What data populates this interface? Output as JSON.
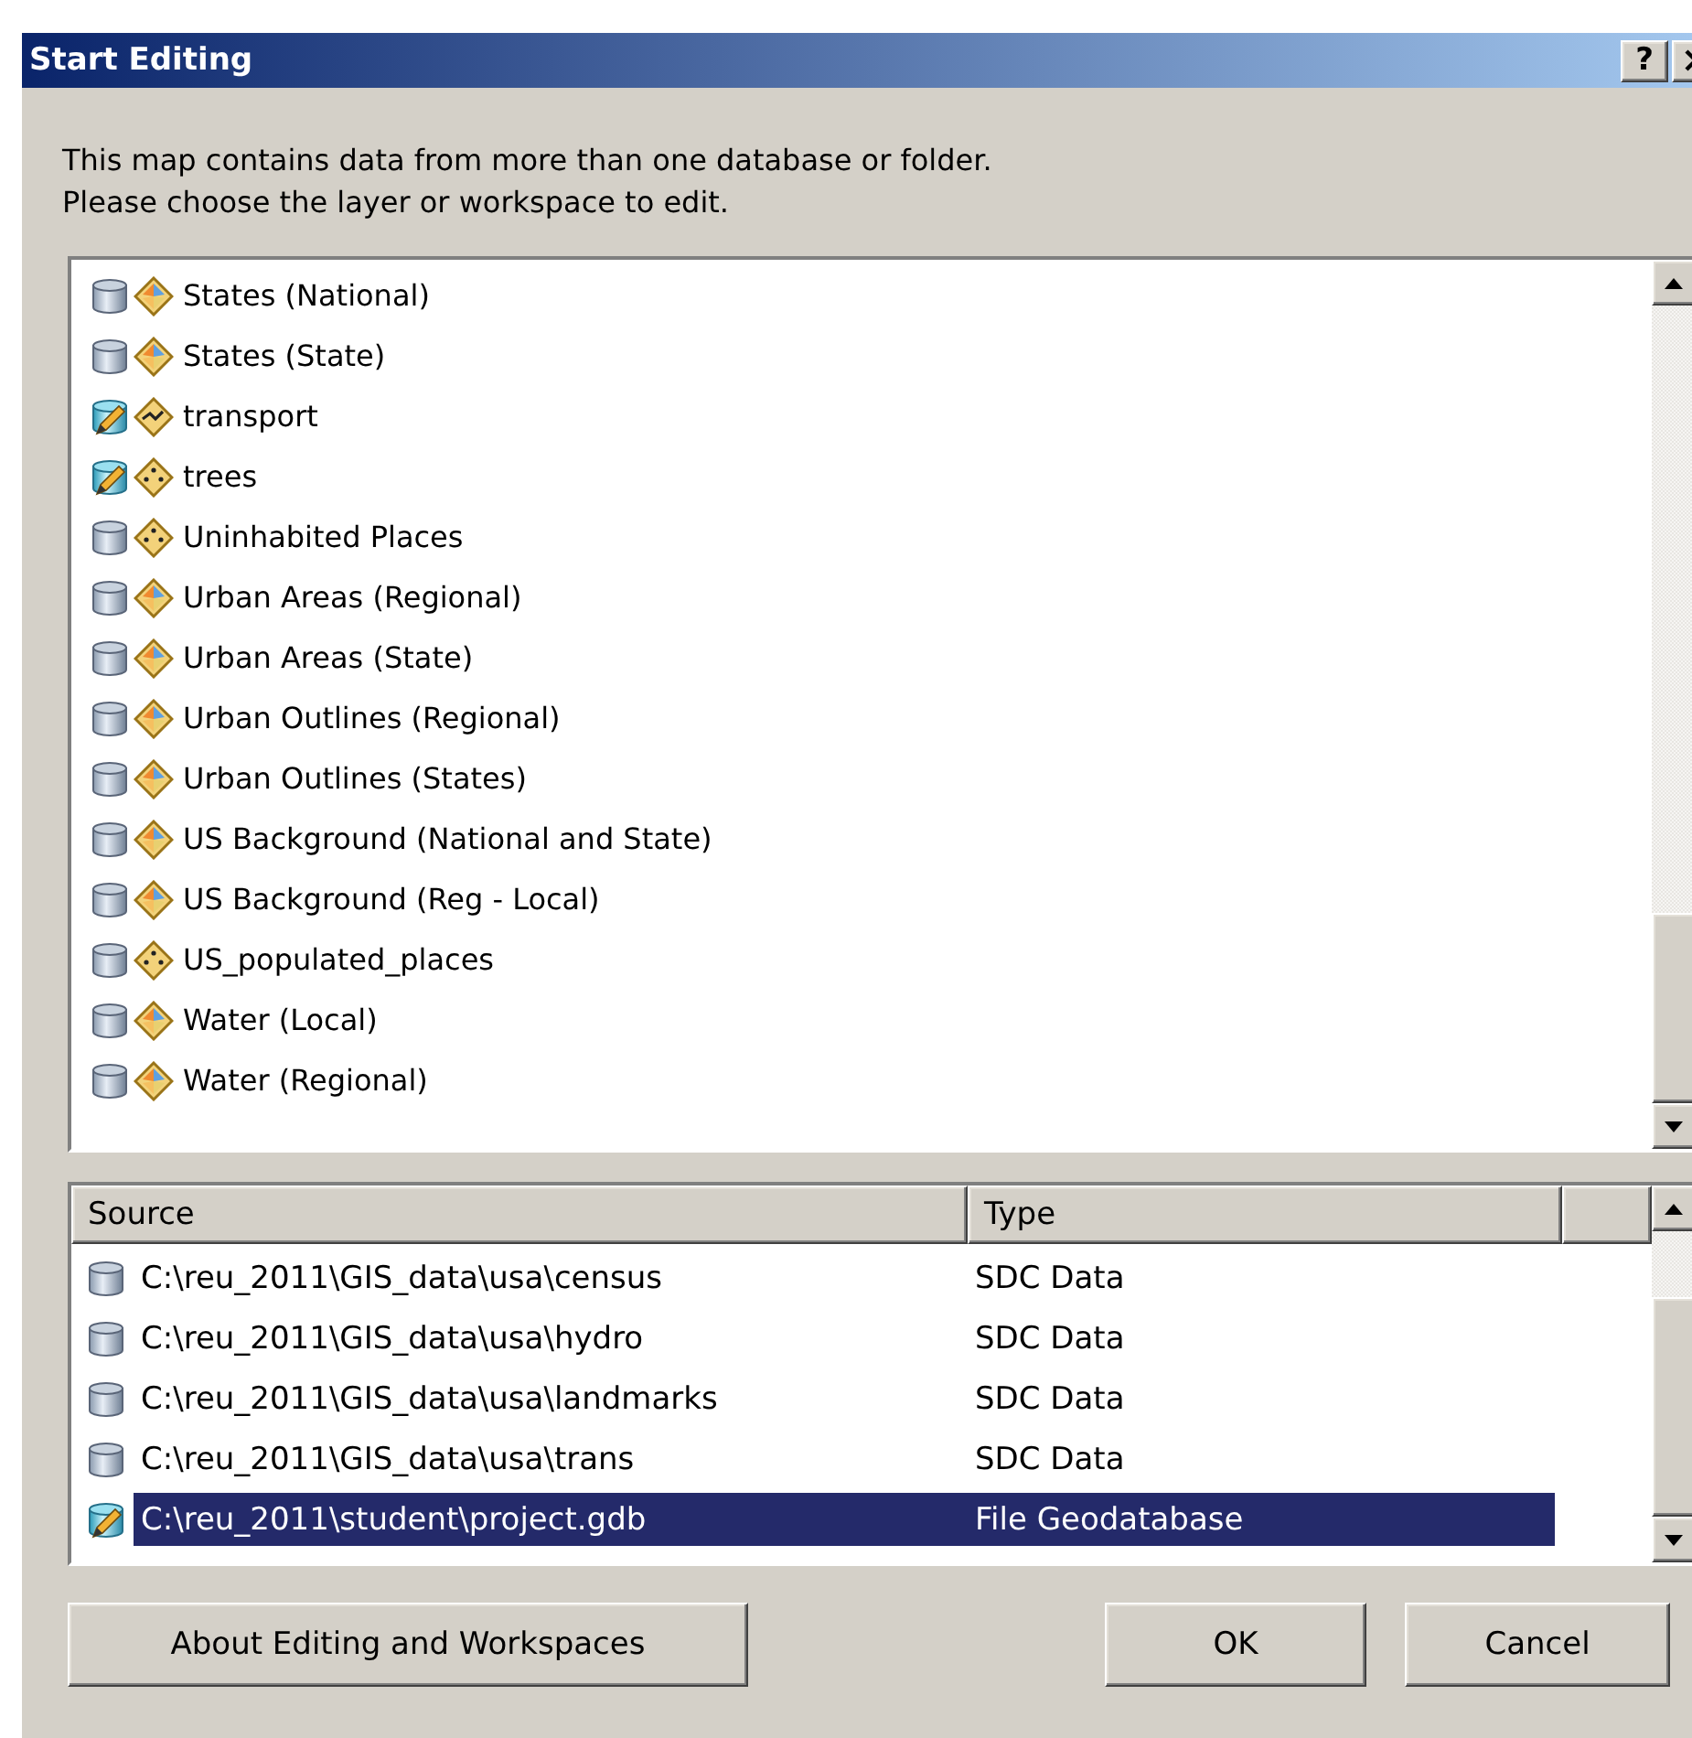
{
  "window": {
    "title": "Start Editing",
    "help": "?"
  },
  "message": [
    "This map contains data from more than one database or folder.",
    "Please choose the layer or workspace to edit."
  ],
  "layers": [
    {
      "label": "States (National)",
      "icons": [
        {
          "kind": "sdc"
        },
        {
          "kind": "polygon"
        }
      ],
      "selected": false
    },
    {
      "label": "States (State)",
      "icons": [
        {
          "kind": "sdc"
        },
        {
          "kind": "polygon"
        }
      ],
      "selected": false
    },
    {
      "label": "transport",
      "icons": [
        {
          "kind": "gdb"
        },
        {
          "kind": "line"
        }
      ],
      "selected": false
    },
    {
      "label": "trees",
      "icons": [
        {
          "kind": "gdb"
        },
        {
          "kind": "point"
        }
      ],
      "selected": false
    },
    {
      "label": "Uninhabited Places",
      "icons": [
        {
          "kind": "sdc"
        },
        {
          "kind": "point"
        }
      ],
      "selected": false
    },
    {
      "label": "Urban Areas (Regional)",
      "icons": [
        {
          "kind": "sdc"
        },
        {
          "kind": "polygon"
        }
      ],
      "selected": false
    },
    {
      "label": "Urban Areas (State)",
      "icons": [
        {
          "kind": "sdc"
        },
        {
          "kind": "polygon"
        }
      ],
      "selected": false
    },
    {
      "label": "Urban Outlines (Regional)",
      "icons": [
        {
          "kind": "sdc"
        },
        {
          "kind": "polygon"
        }
      ],
      "selected": false
    },
    {
      "label": "Urban Outlines (States)",
      "icons": [
        {
          "kind": "sdc"
        },
        {
          "kind": "polygon"
        }
      ],
      "selected": false
    },
    {
      "label": "US Background (National and State)",
      "icons": [
        {
          "kind": "sdc"
        },
        {
          "kind": "polygon"
        }
      ],
      "selected": false
    },
    {
      "label": "US Background (Reg - Local)",
      "icons": [
        {
          "kind": "sdc"
        },
        {
          "kind": "polygon"
        }
      ],
      "selected": false
    },
    {
      "label": "US_populated_places",
      "icons": [
        {
          "kind": "sdc"
        },
        {
          "kind": "point"
        }
      ],
      "selected": false
    },
    {
      "label": "Water (Local)",
      "icons": [
        {
          "kind": "sdc"
        },
        {
          "kind": "polygon"
        }
      ],
      "selected": false
    },
    {
      "label": "Water (Regional)",
      "icons": [
        {
          "kind": "sdc"
        },
        {
          "kind": "polygon"
        }
      ],
      "selected": false
    }
  ],
  "sources": {
    "columns": [
      "Source",
      "Type"
    ],
    "rows": [
      {
        "source": "C:\\reu_2011\\GIS_data\\usa\\census",
        "type": "SDC Data",
        "icon": {
          "kind": "sdc"
        },
        "selected": false
      },
      {
        "source": "C:\\reu_2011\\GIS_data\\usa\\hydro",
        "type": "SDC Data",
        "icon": {
          "kind": "sdc"
        },
        "selected": false
      },
      {
        "source": "C:\\reu_2011\\GIS_data\\usa\\landmarks",
        "type": "SDC Data",
        "icon": {
          "kind": "sdc"
        },
        "selected": false
      },
      {
        "source": "C:\\reu_2011\\GIS_data\\usa\\trans",
        "type": "SDC Data",
        "icon": {
          "kind": "sdc"
        },
        "selected": false
      },
      {
        "source": "C:\\reu_2011\\student\\project.gdb",
        "type": "File Geodatabase",
        "icon": {
          "kind": "gdb"
        },
        "selected": true
      }
    ]
  },
  "buttons": {
    "about": "About Editing and Workspaces",
    "ok": "OK",
    "cancel": "Cancel"
  }
}
